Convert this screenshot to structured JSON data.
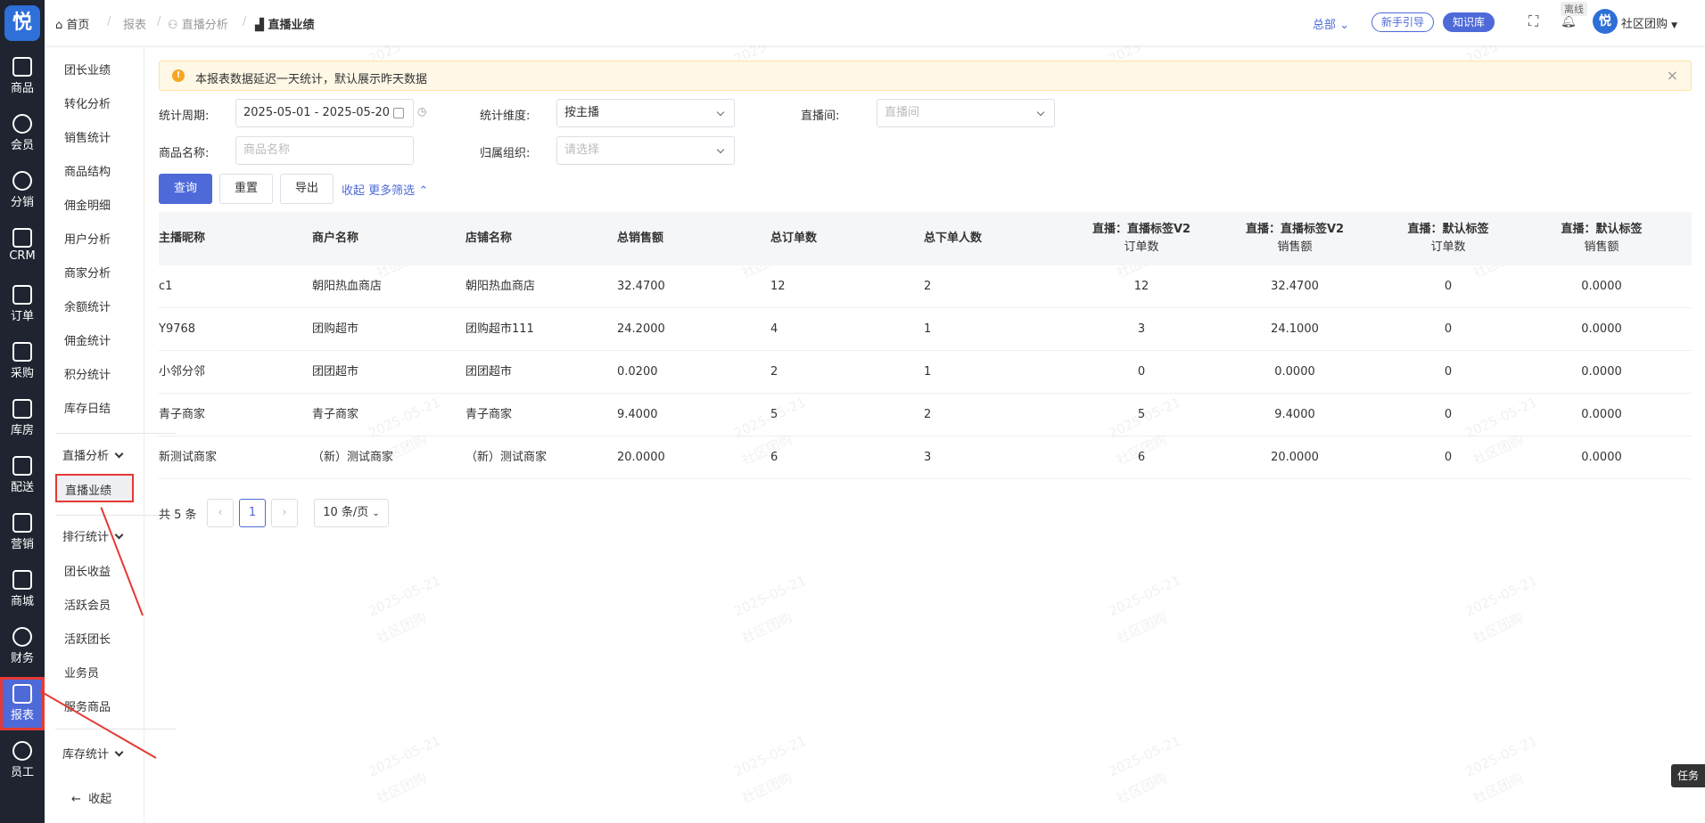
{
  "rail": {
    "logo": "悦",
    "items": [
      {
        "label": "商品",
        "icon": "bag-icon"
      },
      {
        "label": "会员",
        "icon": "user-icon"
      },
      {
        "label": "分销",
        "icon": "share-tree-icon"
      },
      {
        "label": "CRM",
        "icon": "crm-icon"
      },
      {
        "label": "订单",
        "icon": "order-icon"
      },
      {
        "label": "采购",
        "icon": "clipboard-icon"
      },
      {
        "label": "库房",
        "icon": "warehouse-icon"
      },
      {
        "label": "配送",
        "icon": "truck-icon"
      },
      {
        "label": "营销",
        "icon": "gift-icon"
      },
      {
        "label": "商城",
        "icon": "home-icon"
      },
      {
        "label": "财务",
        "icon": "yen-icon"
      },
      {
        "label": "报表",
        "icon": "chart-icon"
      },
      {
        "label": "员工",
        "icon": "staff-icon"
      }
    ]
  },
  "submenu": {
    "items": [
      "团长业绩",
      "转化分析",
      "销售统计",
      "商品结构",
      "佣金明细",
      "用户分析",
      "商家分析",
      "余额统计",
      "佣金统计",
      "积分统计",
      "库存日结"
    ],
    "group_live": "直播分析",
    "active": "直播业绩",
    "group_rank": "排行统计",
    "items2": [
      "团长收益",
      "活跃会员",
      "活跃团长",
      "业务员",
      "服务商品"
    ],
    "group_stock": "库存统计",
    "collapse": "收起"
  },
  "header": {
    "home": "首页",
    "bc1": "报表",
    "bc2": "直播分析",
    "bc3": "直播业绩",
    "scope": "总部",
    "guide": "新手引导",
    "kb": "知识库",
    "offline": "离线",
    "org": "社区团购"
  },
  "notice": "本报表数据延迟一天统计，默认展示昨天数据",
  "filters": {
    "period_label": "统计周期:",
    "period_value": "2025-05-01 - 2025-05-20",
    "dim_label": "统计维度:",
    "dim_value": "按主播",
    "room_label": "直播间:",
    "room_placeholder": "直播间",
    "goods_label": "商品名称:",
    "goods_placeholder": "商品名称",
    "org_label": "归属组织:",
    "org_placeholder": "请选择"
  },
  "actions": {
    "query": "查询",
    "reset": "重置",
    "export": "导出",
    "collapse": "收起",
    "more": "更多筛选"
  },
  "table": {
    "headers": [
      "主播昵称",
      "商户名称",
      "店铺名称",
      "总销售额",
      "总订单数",
      "总下单人数"
    ],
    "headers2": [
      {
        "l1": "直播：直播标签V2",
        "l2": "订单数"
      },
      {
        "l1": "直播：直播标签V2",
        "l2": "销售额"
      },
      {
        "l1": "直播：默认标签",
        "l2": "订单数"
      },
      {
        "l1": "直播：默认标签",
        "l2": "销售额"
      }
    ],
    "rows": [
      [
        "c1",
        "朝阳热血商店",
        "朝阳热血商店",
        "32.4700",
        "12",
        "2",
        "12",
        "32.4700",
        "0",
        "0.0000"
      ],
      [
        "Y9768",
        "团购超市",
        "团购超市111",
        "24.2000",
        "4",
        "1",
        "3",
        "24.1000",
        "0",
        "0.0000"
      ],
      [
        "小邻分邻",
        "团团超市",
        "团团超市",
        "0.0200",
        "2",
        "1",
        "0",
        "0.0000",
        "0",
        "0.0000"
      ],
      [
        "青子商家",
        "青子商家",
        "青子商家",
        "9.4000",
        "5",
        "2",
        "5",
        "9.4000",
        "0",
        "0.0000"
      ],
      [
        "新测试商家",
        "（新）测试商家",
        "（新）测试商家",
        "20.0000",
        "6",
        "3",
        "6",
        "20.0000",
        "0",
        "0.0000"
      ]
    ]
  },
  "pagination": {
    "total": "共 5 条",
    "prev": "‹",
    "page": "1",
    "next": "›",
    "size": "10 条/页"
  },
  "task": "任务",
  "watermark": {
    "date": "2025-05-21",
    "org": "社区团购"
  }
}
